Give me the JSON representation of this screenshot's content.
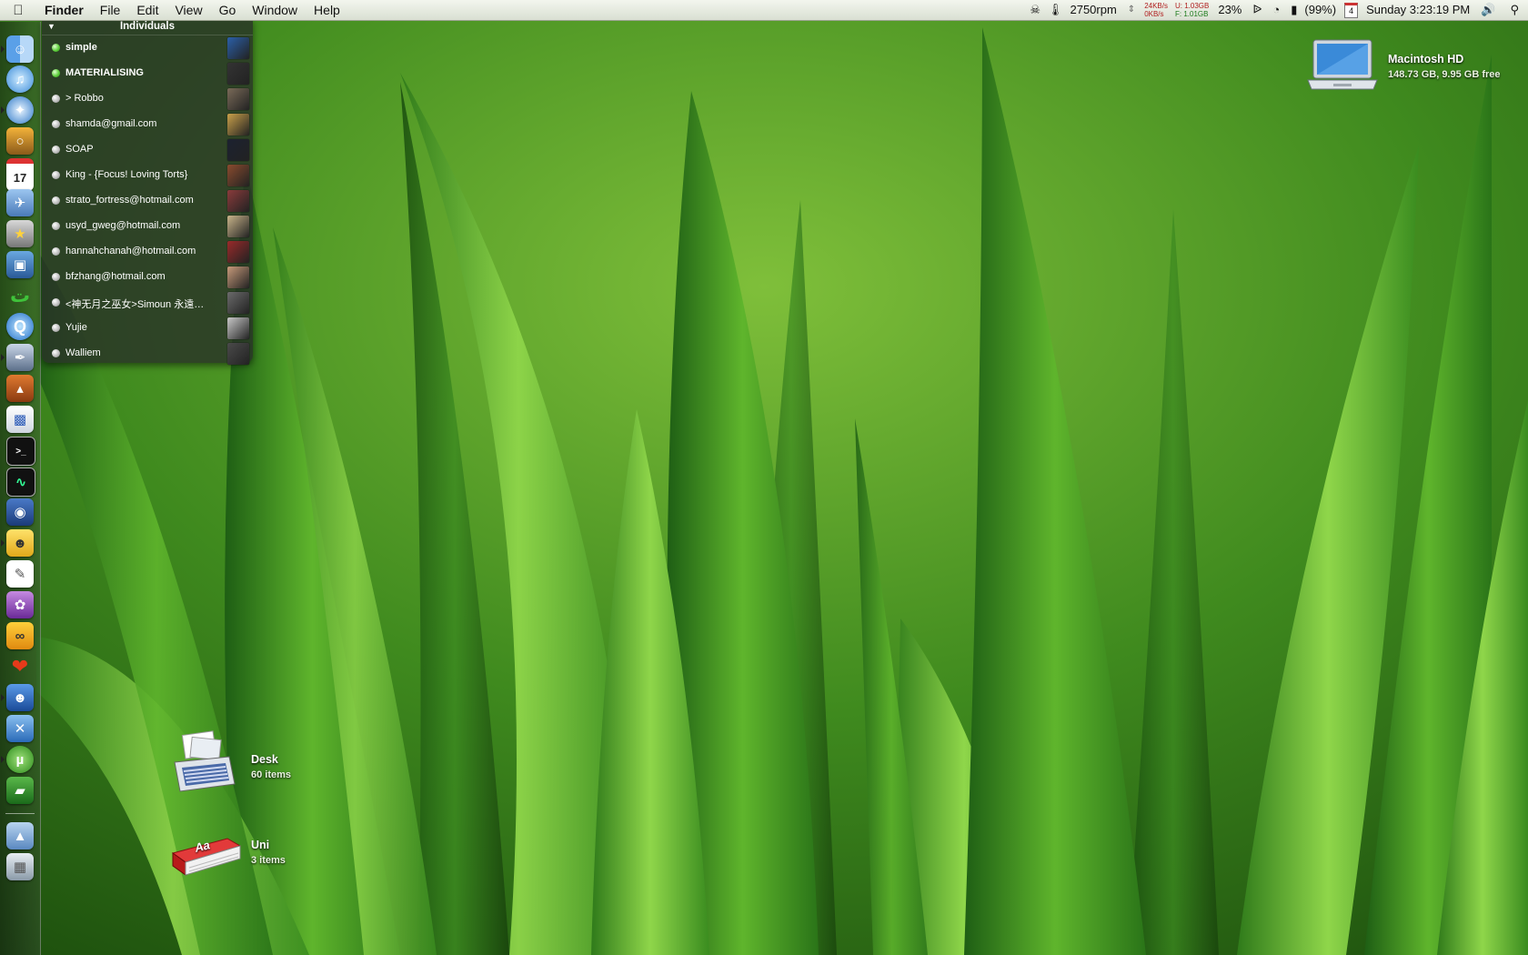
{
  "menubar": {
    "app_name": "Finder",
    "menus": [
      "File",
      "Edit",
      "View",
      "Go",
      "Window",
      "Help"
    ],
    "status": {
      "fan_speed": "2750rpm",
      "net_up": "24KB/s",
      "net_down": "0KB/s",
      "mem_used": "U: 1.03GB",
      "mem_free": "F: 1.01GB",
      "cpu": "23%",
      "battery": "(99%)",
      "calendar_day": "4",
      "clock": "Sunday 3:23:19 PM"
    }
  },
  "dock": {
    "icons": [
      "finder-icon",
      "itunes-icon",
      "safari-icon",
      "iphoto-icon",
      "ical-icon",
      "preview-icon",
      "star-app-icon",
      "photo-booth-icon",
      "green-app-icon",
      "quicktime-icon",
      "pen-app-icon",
      "keynote-icon",
      "charts-app-icon",
      "terminal-icon",
      "activity-monitor-icon",
      "binoculars-icon",
      "adium-icon",
      "textedit-icon",
      "purple-app-icon",
      "orange-app-icon",
      "red-app-icon",
      "blue-guy-icon",
      "xcode-icon",
      "utorrent-icon",
      "green-book-icon",
      "applications-folder-icon",
      "trash-icon"
    ]
  },
  "buddy_list": {
    "group_name": "Individuals",
    "buddies": [
      {
        "name": "simple",
        "online": true,
        "avatar_color": "#2b5fa8"
      },
      {
        "name": "MATERIALISING",
        "online": true,
        "avatar_color": "#333333"
      },
      {
        "name": "> Robbo",
        "online": false,
        "avatar_color": "#7a6a58"
      },
      {
        "name": "shamda@gmail.com",
        "online": false,
        "avatar_color": "#c9a04a"
      },
      {
        "name": "SOAP",
        "online": false,
        "avatar_color": "#1c2230"
      },
      {
        "name": "King - {Focus! Loving Torts}",
        "online": false,
        "avatar_color": "#8a4b2e"
      },
      {
        "name": "strato_fortress@hotmail.com",
        "online": false,
        "avatar_color": "#8a3b3b"
      },
      {
        "name": "usyd_gweg@hotmail.com",
        "online": false,
        "avatar_color": "#c9b48a"
      },
      {
        "name": "hannahchanah@hotmail.com",
        "online": false,
        "avatar_color": "#9a2a2a"
      },
      {
        "name": "bfzhang@hotmail.com",
        "online": false,
        "avatar_color": "#c79a7a"
      },
      {
        "name": "<神无月之巫女>Simoun 永遠…",
        "online": false,
        "avatar_color": "#6b6b6b"
      },
      {
        "name": "Yujie",
        "online": false,
        "avatar_color": "#c8c8c8"
      },
      {
        "name": "Walliem",
        "online": false,
        "avatar_color": "#4a4a4a"
      }
    ]
  },
  "desktop": {
    "hd_name": "Macintosh HD",
    "hd_info": "148.73 GB, 9.95 GB free",
    "desk_folder_name": "Desk",
    "desk_folder_count": "60 items",
    "uni_folder_name": "Uni",
    "uni_folder_count": "3 items",
    "uni_icon_text": "Aa"
  }
}
